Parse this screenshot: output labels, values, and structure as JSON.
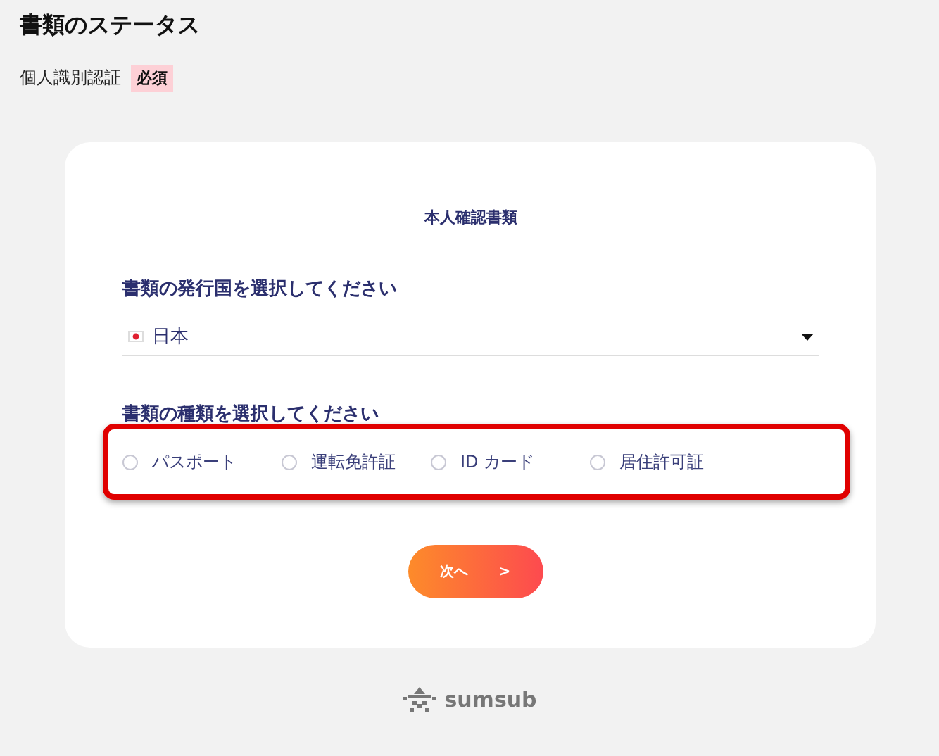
{
  "page_title": "書類のステータス",
  "requirement": {
    "label": "個人識別認証",
    "badge": "必須"
  },
  "card": {
    "title": "本人確認書類",
    "country": {
      "label": "書類の発行国を選択してください",
      "value": "日本"
    },
    "document_type": {
      "label": "書類の種類を選択してください",
      "highlighted": true,
      "options": [
        {
          "label": "パスポート",
          "selected": false
        },
        {
          "label": "運転免許証",
          "selected": false
        },
        {
          "label": "ID カード",
          "selected": false
        },
        {
          "label": "居住許可証",
          "selected": false
        }
      ]
    },
    "next_button": {
      "label": "次へ",
      "arrow": ">"
    }
  },
  "footer": {
    "logo_text": "sumsub"
  }
}
